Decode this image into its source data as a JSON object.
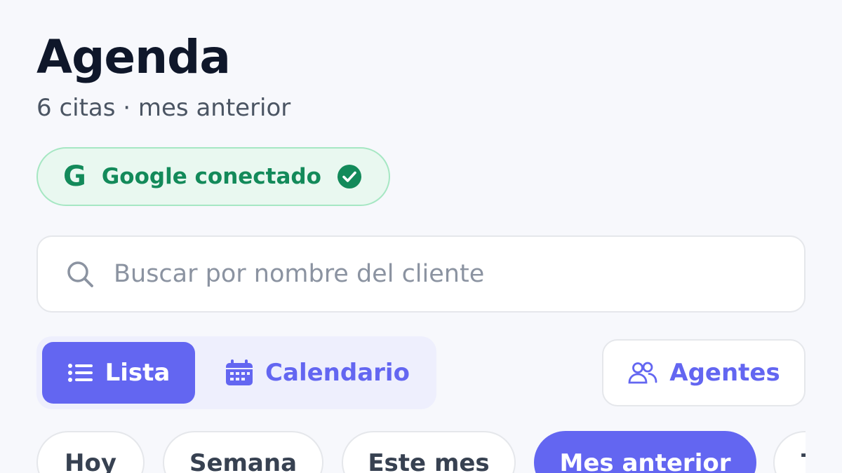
{
  "header": {
    "title": "Agenda",
    "subtitle": "6 citas · mes anterior"
  },
  "google": {
    "icon_letter": "G",
    "label": "Google conectado",
    "status_icon": "check-circle-icon",
    "color": "#138a5a"
  },
  "search": {
    "icon": "search-icon",
    "value": "",
    "placeholder": "Buscar por nombre del cliente"
  },
  "view_toggle": {
    "selected": "Lista",
    "options": [
      {
        "label": "Lista",
        "icon": "list-icon"
      },
      {
        "label": "Calendario",
        "icon": "calendar-icon"
      }
    ]
  },
  "agents_button": {
    "label": "Agentes",
    "icon": "users-icon"
  },
  "filters": {
    "selected": "Mes anterior",
    "items": [
      "Hoy",
      "Semana",
      "Este mes",
      "Mes anterior",
      "T"
    ]
  },
  "colors": {
    "accent": "#6366f1",
    "background": "#f7f8fc",
    "success": "#138a5a"
  }
}
